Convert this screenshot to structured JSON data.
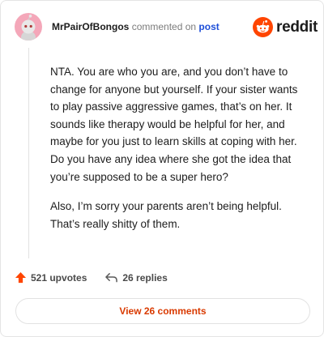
{
  "comment": {
    "username": "MrPairOfBongos",
    "action_text": "commented on",
    "post_link": "post",
    "paragraphs": [
      "NTA. You are who you are, and you don’t have to change for anyone but yourself. If your sister wants to play passive aggressive games, that’s on her. It sounds like therapy would be helpful for her, and maybe for you just to learn skills at coping with her. Do you have any idea where she got the idea that you’re supposed to be a super hero?",
      "Also, I’m sorry your parents aren’t being helpful. That’s really shitty of them."
    ]
  },
  "brand": {
    "wordmark": "reddit",
    "color": "#ff4500"
  },
  "actions": {
    "upvotes": "521 upvotes",
    "replies": "26 replies",
    "upvote_icon": "upvote-arrow-icon",
    "reply_icon": "reply-arrow-icon"
  },
  "footer": {
    "view_comments": "View 26 comments"
  },
  "colors": {
    "link": "#1d4ed8",
    "upvote": "#ff4500",
    "view_button": "#d93a00",
    "avatar_bg": "#f4a7b9"
  }
}
